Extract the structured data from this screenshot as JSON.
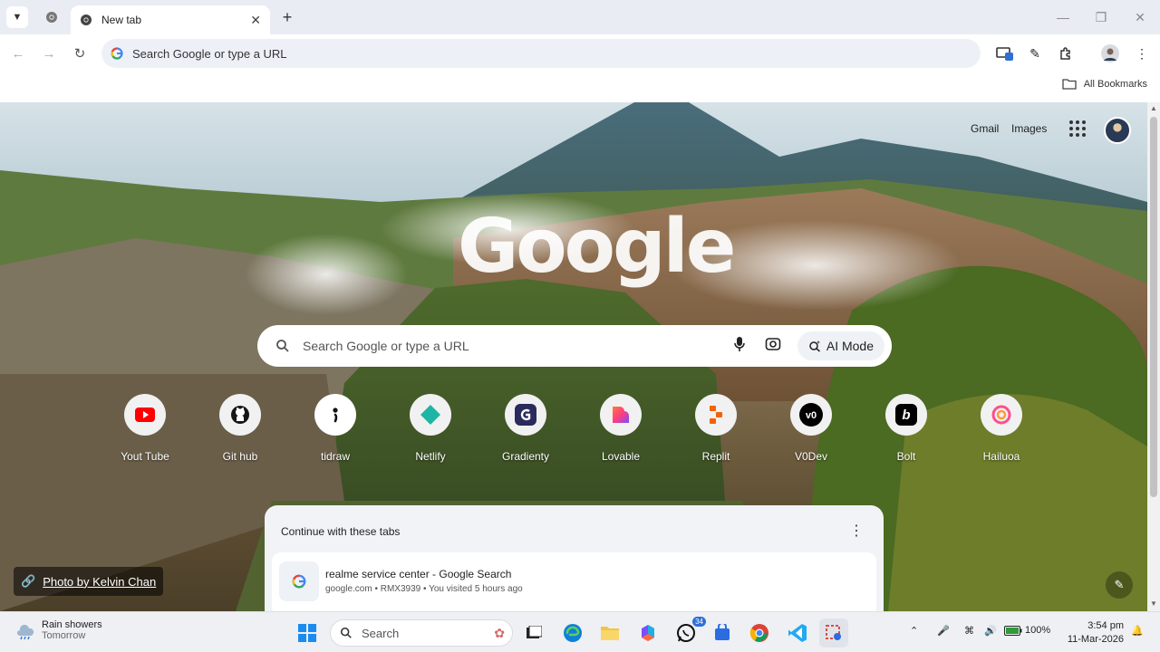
{
  "browser": {
    "tabs": [
      {
        "title": "New tab",
        "active": true
      }
    ],
    "omnibox": {
      "placeholder": "Search Google or type a URL"
    },
    "bookmarks": {
      "all_label": "All Bookmarks"
    }
  },
  "page": {
    "header_links": {
      "gmail": "Gmail",
      "images": "Images"
    },
    "logo_text": "Google",
    "search": {
      "placeholder": "Search Google or type a URL",
      "ai_mode_label": "AI Mode"
    },
    "shortcuts": [
      {
        "label": "Yout Tube",
        "icon": "youtube-icon"
      },
      {
        "label": "Git hub",
        "icon": "github-icon"
      },
      {
        "label": "tidraw",
        "icon": "tldraw-icon"
      },
      {
        "label": "Netlify",
        "icon": "netlify-icon"
      },
      {
        "label": "Gradienty",
        "icon": "gradienty-icon"
      },
      {
        "label": "Lovable",
        "icon": "lovable-icon"
      },
      {
        "label": "Replit",
        "icon": "replit-icon"
      },
      {
        "label": "V0Dev",
        "icon": "v0-icon"
      },
      {
        "label": "Bolt",
        "icon": "bolt-icon"
      },
      {
        "label": "Hailuoa",
        "icon": "hailuo-icon"
      }
    ],
    "photo_credit": "Photo by Kelvin Chan",
    "continue_tabs": {
      "header": "Continue with these tabs",
      "items": [
        {
          "title": "realme service center - Google Search",
          "meta": "google.com • RMX3939 • You visited 5 hours ago"
        }
      ]
    }
  },
  "taskbar": {
    "weather": {
      "condition": "Rain showers",
      "when": "Tomorrow"
    },
    "search_label": "Search",
    "whatsapp_badge": "34",
    "battery": "100%",
    "time": "3:54 pm",
    "date": "11-Mar-2026"
  }
}
